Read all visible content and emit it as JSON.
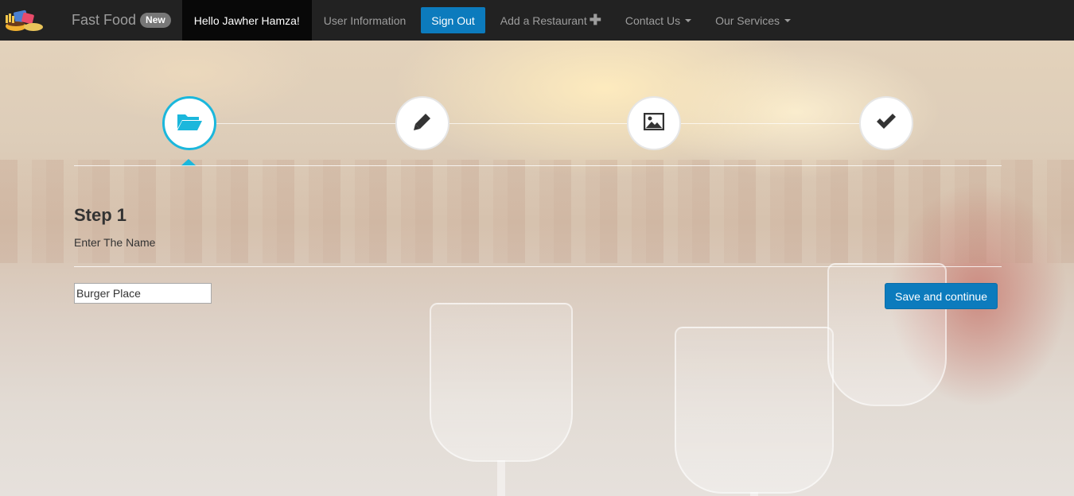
{
  "navbar": {
    "logo_icon": "fast-food-logo-icon",
    "brand": "Fast Food",
    "badge": "New",
    "greeting": "Hello Jawher Hamza!",
    "user_info": "User Information",
    "sign_out": "Sign Out",
    "add_restaurant": "Add a Restaurant",
    "add_icon": "plus-icon",
    "contact": "Contact Us",
    "services": "Our Services"
  },
  "wizard": {
    "steps": [
      {
        "icon": "folder-open-icon",
        "active": true
      },
      {
        "icon": "pencil-icon",
        "active": false
      },
      {
        "icon": "picture-icon",
        "active": false
      },
      {
        "icon": "checkmark-icon",
        "active": false
      }
    ],
    "current": {
      "title": "Step 1",
      "description": "Enter The Name"
    },
    "name_field": {
      "value": "Burger Place"
    },
    "save_button": "Save and continue"
  },
  "colors": {
    "navbar_bg": "#222222",
    "accent_blue": "#0c7bbd",
    "step_active": "#1bb7dc"
  }
}
